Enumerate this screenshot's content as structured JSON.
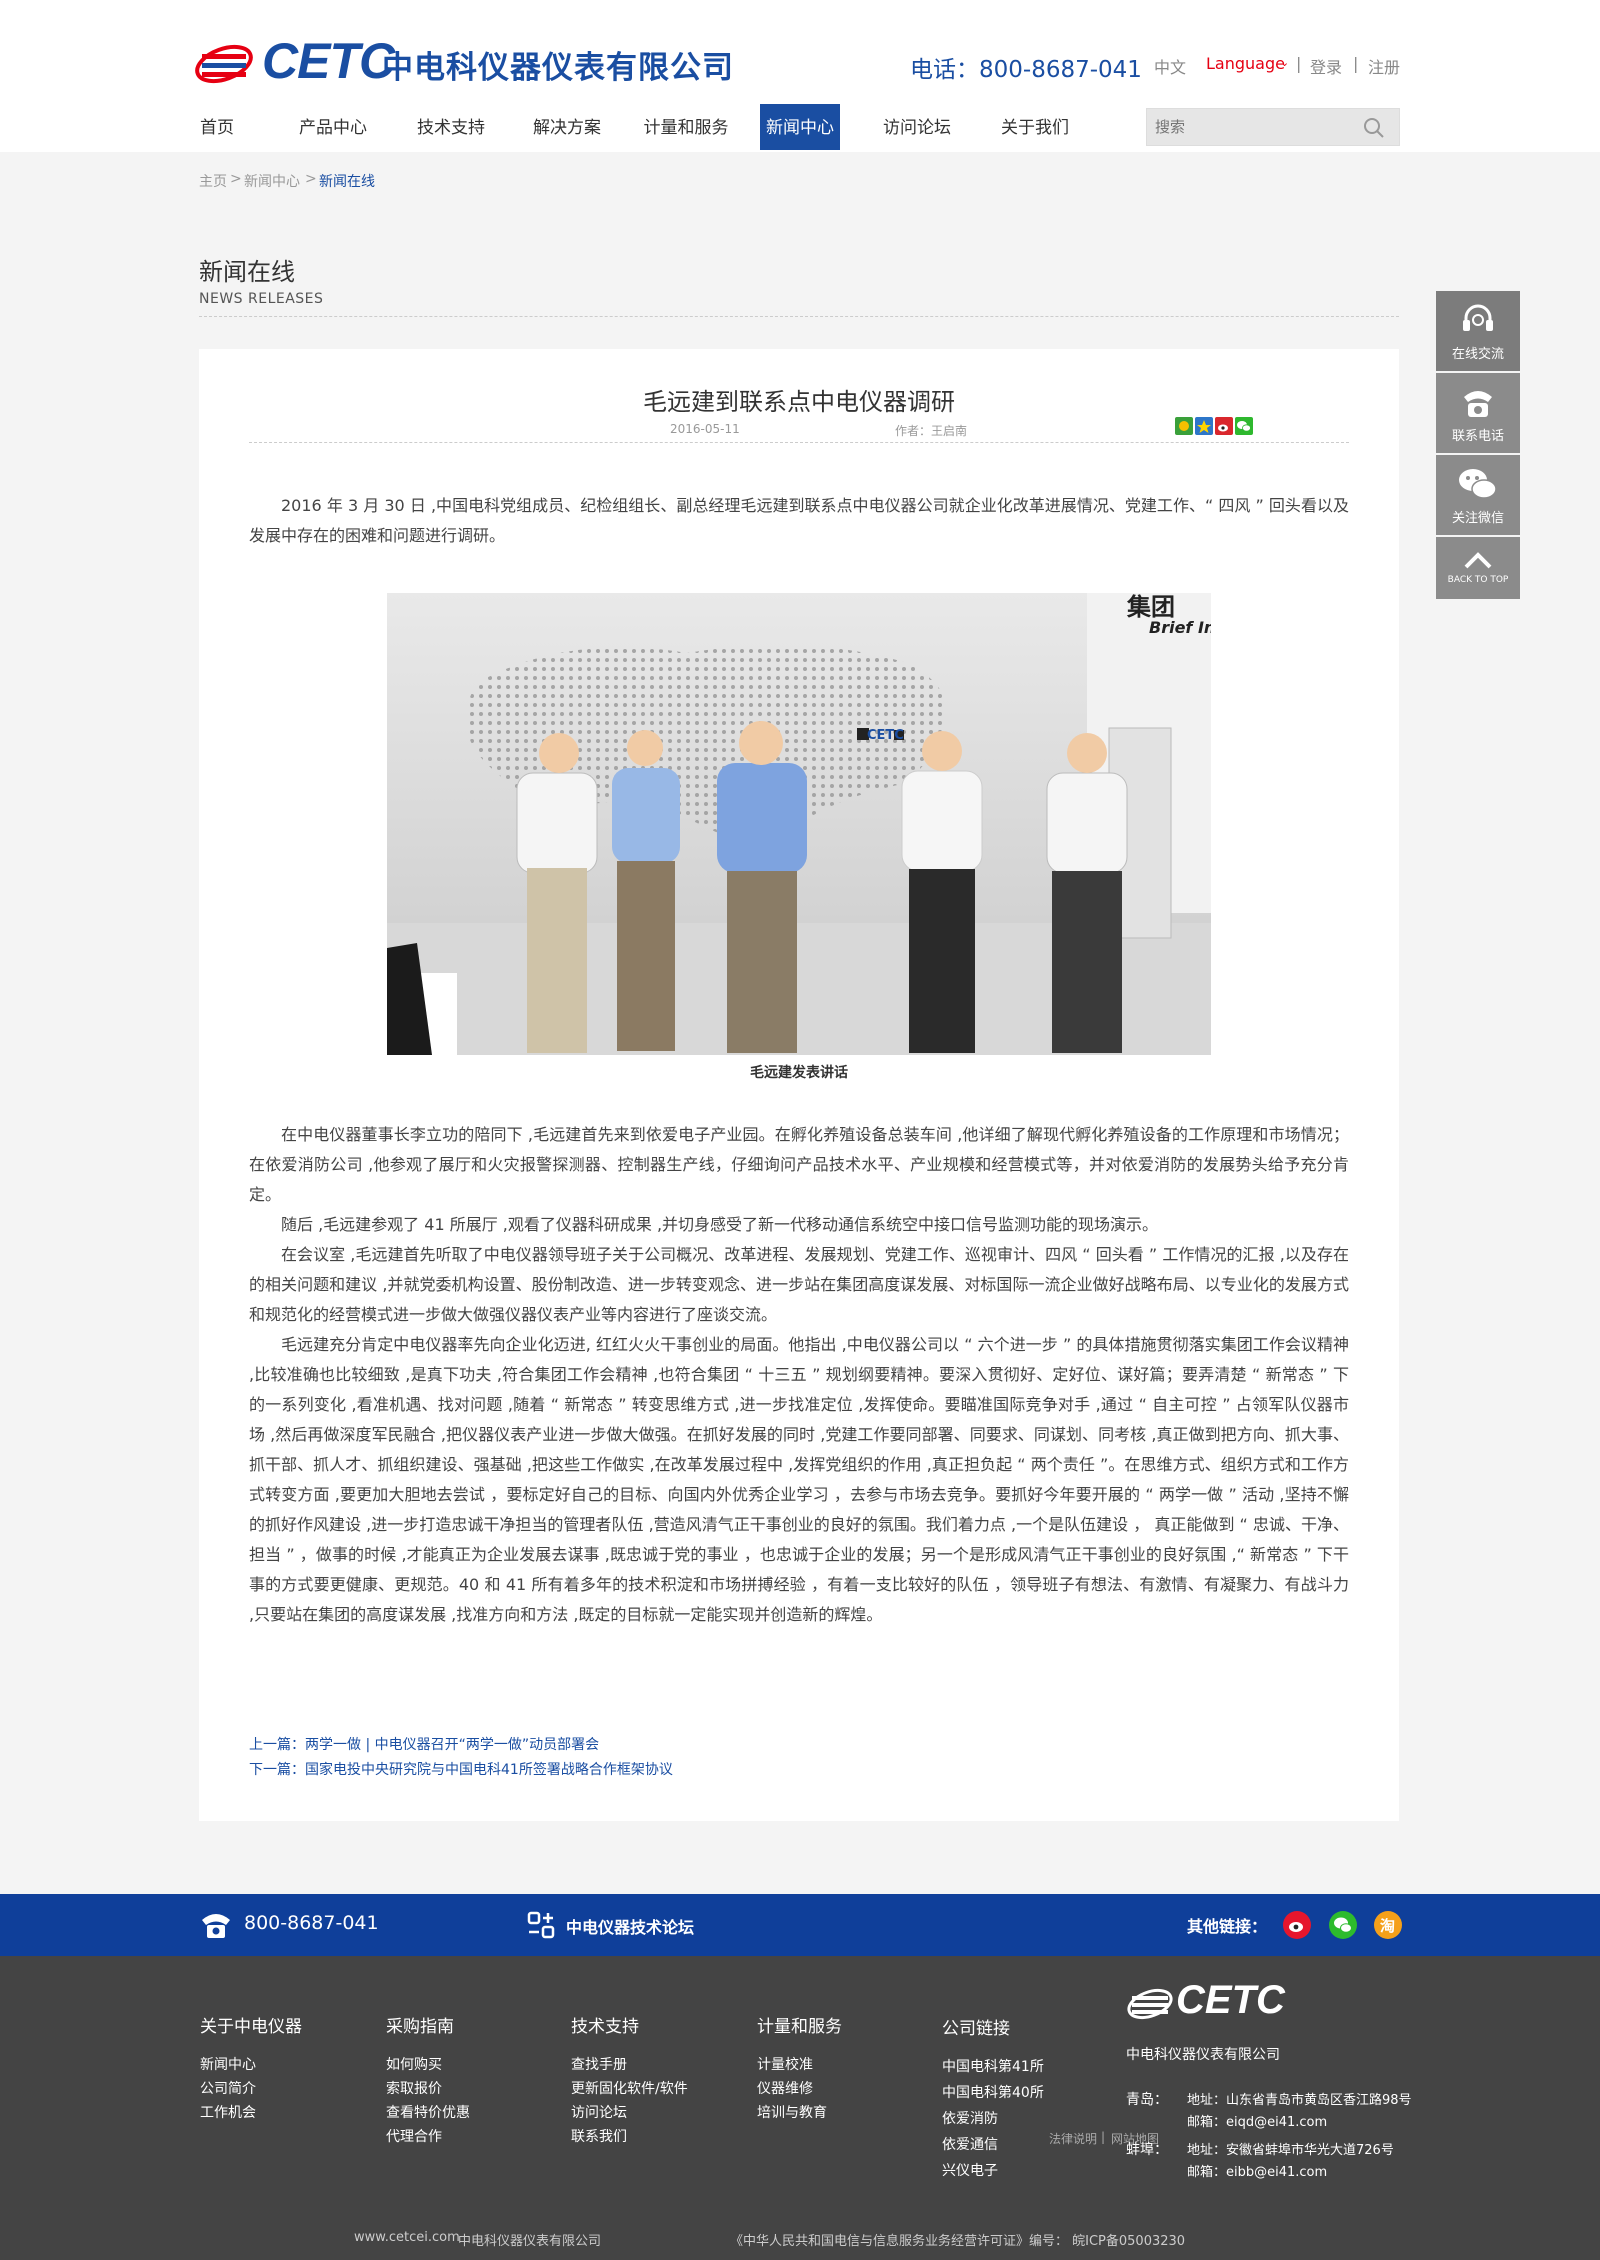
{
  "header": {
    "logo_text": "CETC",
    "company_name": "中电科仪器仪表有限公司",
    "phone": "电话：800-8687-041",
    "lang_cn": "中文",
    "lang_switch": "Language",
    "login": "登录",
    "register": "注册",
    "sep": "|",
    "search_placeholder": "搜索"
  },
  "nav": {
    "items": [
      {
        "label": "首页"
      },
      {
        "label": "产品中心"
      },
      {
        "label": "技术支持"
      },
      {
        "label": "解决方案"
      },
      {
        "label": "计量和服务"
      },
      {
        "label": "新闻中心",
        "active": true
      },
      {
        "label": "访问论坛"
      },
      {
        "label": "关于我们"
      }
    ]
  },
  "breadcrumb": {
    "items": [
      "主页",
      "新闻中心",
      "新闻在线"
    ],
    "sep": ">"
  },
  "section": {
    "title": "新闻在线",
    "subtitle": "NEWS RELEASES"
  },
  "article": {
    "title": "毛远建到联系点中电仪器调研",
    "date": "2016-05-11",
    "author": "作者：王启南",
    "intro": "2016 年 3 月 30 日 ,中国电科党组成员、纪检组组长、副总经理毛远建到联系点中电仪器公司就企业化改革进展情况、党建工作、“ 四风 ” 回头看以及发展中存在的困难和问题进行调研。",
    "caption": "毛远建发表讲话",
    "paragraphs": [
      "在中电仪器董事长李立功的陪同下 ,毛远建首先来到依爱电子产业园。在孵化养殖设备总装车间 ,他详细了解现代孵化养殖设备的工作原理和市场情况；在依爱消防公司 ,他参观了展厅和火灾报警探测器、控制器生产线，仔细询问产品技术水平、产业规模和经营模式等，并对依爱消防的发展势头给予充分肯定。",
      "随后 ,毛远建参观了 41 所展厅 ,观看了仪器科研成果 ,并切身感受了新一代移动通信系统空中接口信号监测功能的现场演示。",
      "在会议室 ,毛远建首先听取了中电仪器领导班子关于公司概况、改革进程、发展规划、党建工作、巡视审计、四风 “ 回头看 ” 工作情况的汇报 ,以及存在的相关问题和建议 ,并就党委机构设置、股份制改造、进一步转变观念、进一步站在集团高度谋发展、对标国际一流企业做好战略布局、以专业化的发展方式和规范化的经营模式进一步做大做强仪器仪表产业等内容进行了座谈交流。",
      "毛远建充分肯定中电仪器率先向企业化迈进, 红红火火干事创业的局面。他指出 ,中电仪器公司以 “ 六个进一步 ” 的具体措施贯彻落实集团工作会议精神 ,比较准确也比较细致 ,是真下功夫 ,符合集团工作会精神 ,也符合集团 “ 十三五 ” 规划纲要精神。要深入贯彻好、定好位、谋好篇；要弄清楚 “ 新常态 ” 下的一系列变化 ,看准机遇、找对问题 ,随着 “ 新常态 ” 转变思维方式 ,进一步找准定位 ,发挥使命。要瞄准国际竞争对手 ,通过 “ 自主可控 ” 占领军队仪器市场 ,然后再做深度军民融合 ,把仪器仪表产业进一步做大做强。在抓好发展的同时 ,党建工作要同部署、同要求、同谋划、同考核 ,真正做到把方向、抓大事、抓干部、抓人才、抓组织建设、强基础 ,把这些工作做实 ,在改革发展过程中 ,发挥党组织的作用 ,真正担负起 “ 两个责任 ”。在思维方式、组织方式和工作方式转变方面 ,要更加大胆地去尝试 ，要标定好自己的目标、向国内外优秀企业学习 ，去参与市场去竞争。要抓好今年要开展的 “ 两学一做 ” 活动 ,坚持不懈的抓好作风建设 ,进一步打造忠诚干净担当的管理者队伍 ,营造风清气正干事创业的良好的氛围。我们着力点 ,一个是队伍建设 ， 真正能做到 “ 忠诚、干净、担当 ” ，做事的时候 ,才能真正为企业发展去谋事 ,既忠诚于党的事业 ，也忠诚于企业的发展；另一个是形成风清气正干事创业的良好氛围 ,“ 新常态 ” 下干事的方式要更健康、更规范。40 和 41 所有着多年的技术积淀和市场拼搏经验 ，有着一支比较好的队伍 ，领导班子有想法、有激情、有凝聚力、有战斗力 ,只要站在集团的高度谋发展 ,找准方向和方法 ,既定的目标就一定能实现并创造新的辉煌。"
    ],
    "prev": "上一篇：两学一做 | 中电仪器召开“两学一做”动员部署会",
    "next": "下一篇：国家电投中央研究院与中国电科41所签署战略合作框架协议"
  },
  "sidebar": {
    "items": [
      {
        "label": "在线交流",
        "icon": "headset-icon"
      },
      {
        "label": "联系电话",
        "icon": "phone-icon"
      },
      {
        "label": "关注微信",
        "icon": "wechat-icon"
      },
      {
        "label": "BACK TO TOP",
        "icon": "chevron-up-icon"
      }
    ]
  },
  "bluebar": {
    "phone": "800-8687-041",
    "forum": "中电仪器技术论坛",
    "links_label": "其他链接："
  },
  "footer": {
    "columns": [
      {
        "title": "关于中电仪器",
        "items": [
          "新闻中心",
          "公司简介",
          "工作机会"
        ]
      },
      {
        "title": "采购指南",
        "items": [
          "如何购买",
          "索取报价",
          "查看特价优惠",
          "代理合作"
        ]
      },
      {
        "title": "技术支持",
        "items": [
          "查找手册",
          "更新固化软件/软件",
          "访问论坛",
          "联系我们"
        ]
      },
      {
        "title": "计量和服务",
        "items": [
          "计量校准",
          "仪器维修",
          "培训与教育"
        ]
      },
      {
        "title": "公司链接",
        "items": [
          "中国电科第41所",
          "中国电科第40所",
          "依爱消防",
          "依爱通信",
          "兴仪电子"
        ]
      }
    ],
    "legal": "法律说明",
    "sitemap": "网站地图",
    "logo_text": "CETC",
    "company": "中电科仪器仪表有限公司",
    "offices": [
      {
        "city": "青岛：",
        "address": "地址：山东省青岛市黄岛区香江路98号",
        "email": "邮箱：eiqd@ei41.com"
      },
      {
        "city": "蚌埠：",
        "address": "地址：安徽省蚌埠市华光大道726号",
        "email": "邮箱：eibb@ei41.com"
      }
    ],
    "copy_site": "www.cetcei.com",
    "copy_company": "中电科仪器仪表有限公司",
    "copy_license": "《中华人民共和国电信与信息服务业务经营许可证》编号： 皖ICP备05003230"
  },
  "colors": {
    "brand_blue": "#1a4ea2",
    "footer_bar": "#0f3f9a",
    "footer_bg": "#444444",
    "accent_red": "#e60012"
  }
}
